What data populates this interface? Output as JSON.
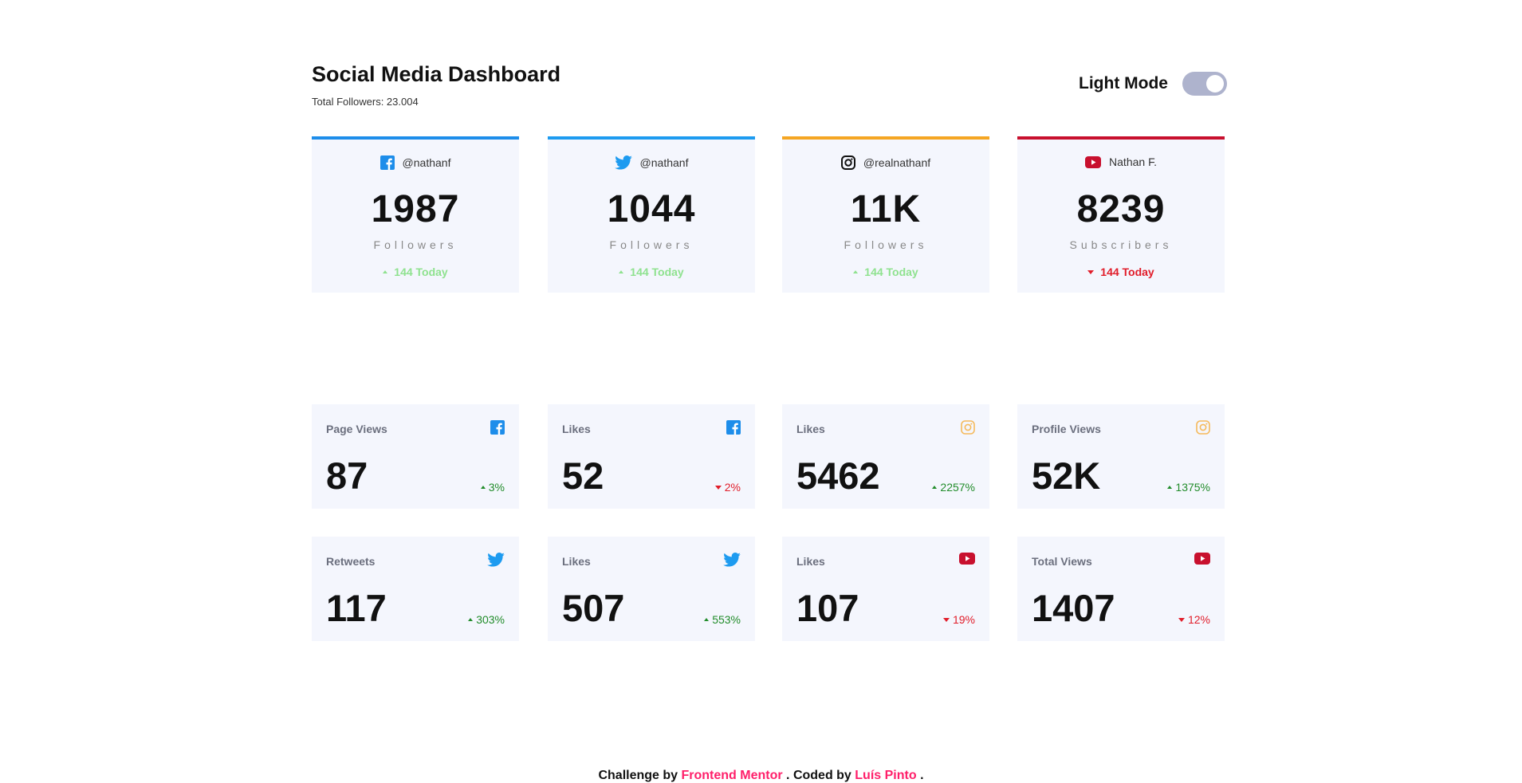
{
  "header": {
    "title": "Social Media Dashboard",
    "total_followers": "Total Followers: 23.004",
    "mode_label": "Light Mode"
  },
  "colors": {
    "facebook": "#1d8dea",
    "twitter": "#1d9bf0",
    "instagram": "#f5a623",
    "youtube": "#c8102e",
    "up_top": "#8fe28f",
    "up_stat": "#218c2a",
    "down": "#e11d2a",
    "card_bg": "#f4f6fd",
    "toggle": "#aeb3cd",
    "link": "#ff1f6a"
  },
  "top_cards": [
    {
      "icon": "facebook-icon",
      "handle": "@nathanf",
      "count": "1987",
      "unit": "Followers",
      "today": "144 Today",
      "trend": "up"
    },
    {
      "icon": "twitter-icon",
      "handle": "@nathanf",
      "count": "1044",
      "unit": "Followers",
      "today": "144 Today",
      "trend": "up"
    },
    {
      "icon": "instagram-icon",
      "handle": "@realnathanf",
      "count": "11K",
      "unit": "Followers",
      "today": "144 Today",
      "trend": "up"
    },
    {
      "icon": "youtube-icon",
      "handle": "Nathan F.",
      "count": "8239",
      "unit": "Subscribers",
      "today": "144 Today",
      "trend": "down"
    }
  ],
  "overview": [
    {
      "label": "Page Views",
      "icon": "facebook-icon",
      "value": "87",
      "pct": "3%",
      "trend": "up"
    },
    {
      "label": "Likes",
      "icon": "facebook-icon",
      "value": "52",
      "pct": "2%",
      "trend": "down"
    },
    {
      "label": "Likes",
      "icon": "instagram-icon",
      "value": "5462",
      "pct": "2257%",
      "trend": "up"
    },
    {
      "label": "Profile Views",
      "icon": "instagram-icon",
      "value": "52K",
      "pct": "1375%",
      "trend": "up"
    },
    {
      "label": "Retweets",
      "icon": "twitter-icon",
      "value": "117",
      "pct": "303%",
      "trend": "up"
    },
    {
      "label": "Likes",
      "icon": "twitter-icon",
      "value": "507",
      "pct": "553%",
      "trend": "up"
    },
    {
      "label": "Likes",
      "icon": "youtube-icon",
      "value": "107",
      "pct": "19%",
      "trend": "down"
    },
    {
      "label": "Total Views",
      "icon": "youtube-icon",
      "value": "1407",
      "pct": "12%",
      "trend": "down"
    }
  ],
  "footer": {
    "challenge_by": "Challenge by",
    "frontend_mentor": "Frontend Mentor",
    "coded_by": ". Coded by",
    "author": "Luís Pinto",
    "end": "."
  }
}
